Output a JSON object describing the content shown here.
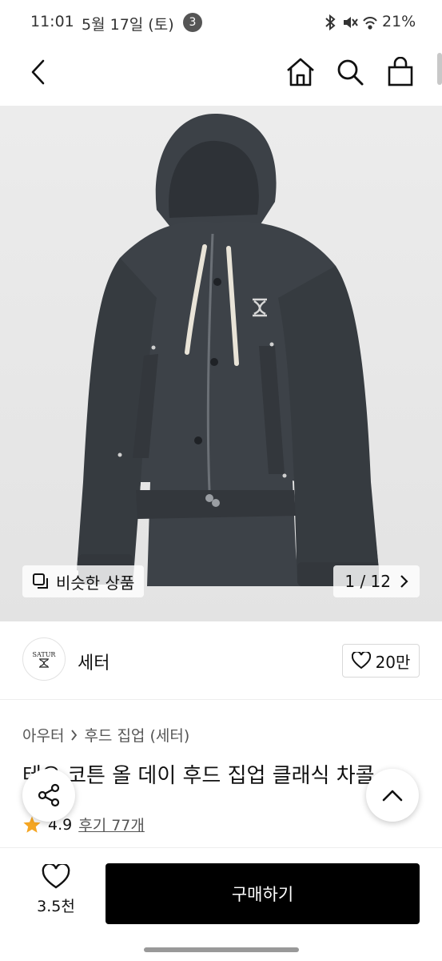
{
  "status_bar": {
    "time": "11:01",
    "date": "5월 17일 (토)",
    "notification_count": "3",
    "battery": "21%"
  },
  "nav": {
    "back_icon": "chevron-left-icon",
    "home_icon": "home-icon",
    "search_icon": "search-icon",
    "bag_icon": "shopping-bag-icon"
  },
  "image": {
    "similar_label": "비슷한 상품",
    "pager": "1 / 12",
    "background": "#e6e6e6",
    "jacket_color": "#3a3f44",
    "drawstring_color": "#e9e4d8"
  },
  "brand": {
    "logo_text": "SATUR",
    "name": "세터",
    "like_count": "20만"
  },
  "product": {
    "breadcrumb": [
      "아우터",
      "후드 집업 (세터)"
    ],
    "title": "테오 코튼 올 데이 후드 집업 클래식 차콜",
    "rating": "4.9",
    "reviews": "후기 77개",
    "star_color": "#f5a623"
  },
  "bottom": {
    "wish_count": "3.5천",
    "buy_label": "구매하기"
  }
}
